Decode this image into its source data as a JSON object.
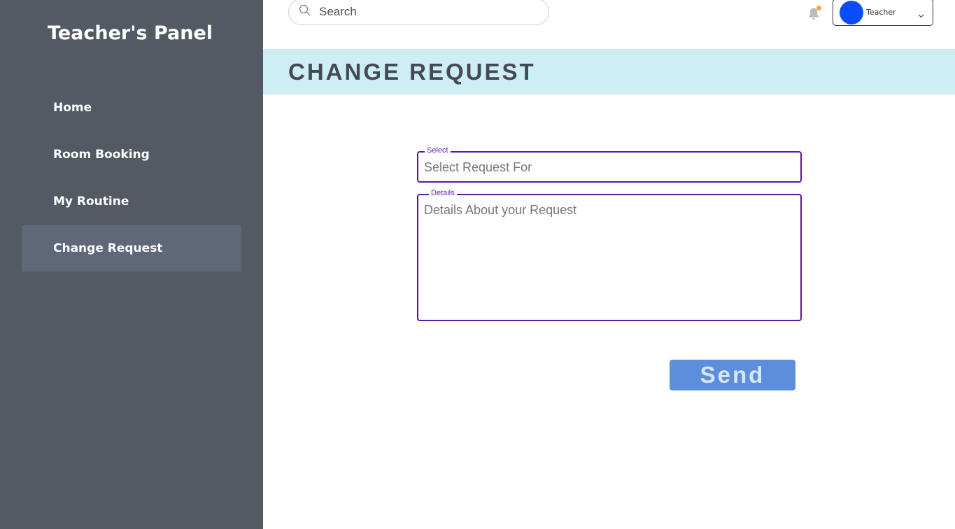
{
  "sidebar": {
    "brand": "Teacher's Panel",
    "items": [
      {
        "label": "Home",
        "active": false
      },
      {
        "label": "Room Booking",
        "active": false
      },
      {
        "label": "My Routine",
        "active": false
      },
      {
        "label": "Change Request",
        "active": true
      }
    ]
  },
  "topbar": {
    "search_placeholder": "Search",
    "search_icon": "search-icon",
    "notification_icon": "bell-icon",
    "user": {
      "name": "Teacher",
      "avatar_color": "#0a4dff"
    }
  },
  "page": {
    "title": "CHANGE REQUEST"
  },
  "form": {
    "select_label": "Select",
    "select_placeholder": "Select Request For",
    "details_label": "Details",
    "details_placeholder": "Details About your Request",
    "send_label": "Send"
  },
  "colors": {
    "sidebar_bg": "#535a64",
    "active_item_bg": "#5f6878",
    "header_bg": "#cdeef4",
    "field_border": "#5b17a8",
    "send_bg": "#5b8fdb"
  }
}
